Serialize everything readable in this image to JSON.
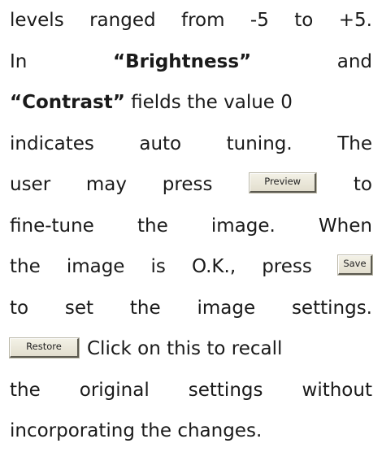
{
  "text": {
    "l1": [
      "levels",
      "ranged",
      "from",
      "-5",
      "to",
      "+5."
    ],
    "l2": [
      "In",
      "“Brightness”",
      "and"
    ],
    "l3_bold": "“Contrast”",
    "l3_rest": " fields the value 0",
    "l4": [
      "indicates",
      "auto",
      "tuning.",
      "The"
    ],
    "l5_before": [
      "user",
      "may",
      "press"
    ],
    "l5_after": "to",
    "l6": [
      "fine-tune",
      "the",
      "image.",
      "When"
    ],
    "l7_before": [
      "the",
      "image",
      "is",
      "O.K.,",
      "press"
    ],
    "l8": [
      "to",
      "set",
      "the",
      "image",
      "settings."
    ],
    "l9_rest": "Click on this to recall",
    "l10": [
      "the",
      "original",
      "settings",
      "without"
    ],
    "l11": "incorporating the changes."
  },
  "buttons": {
    "preview": "Preview",
    "save": "Save",
    "restore": "Restore"
  }
}
